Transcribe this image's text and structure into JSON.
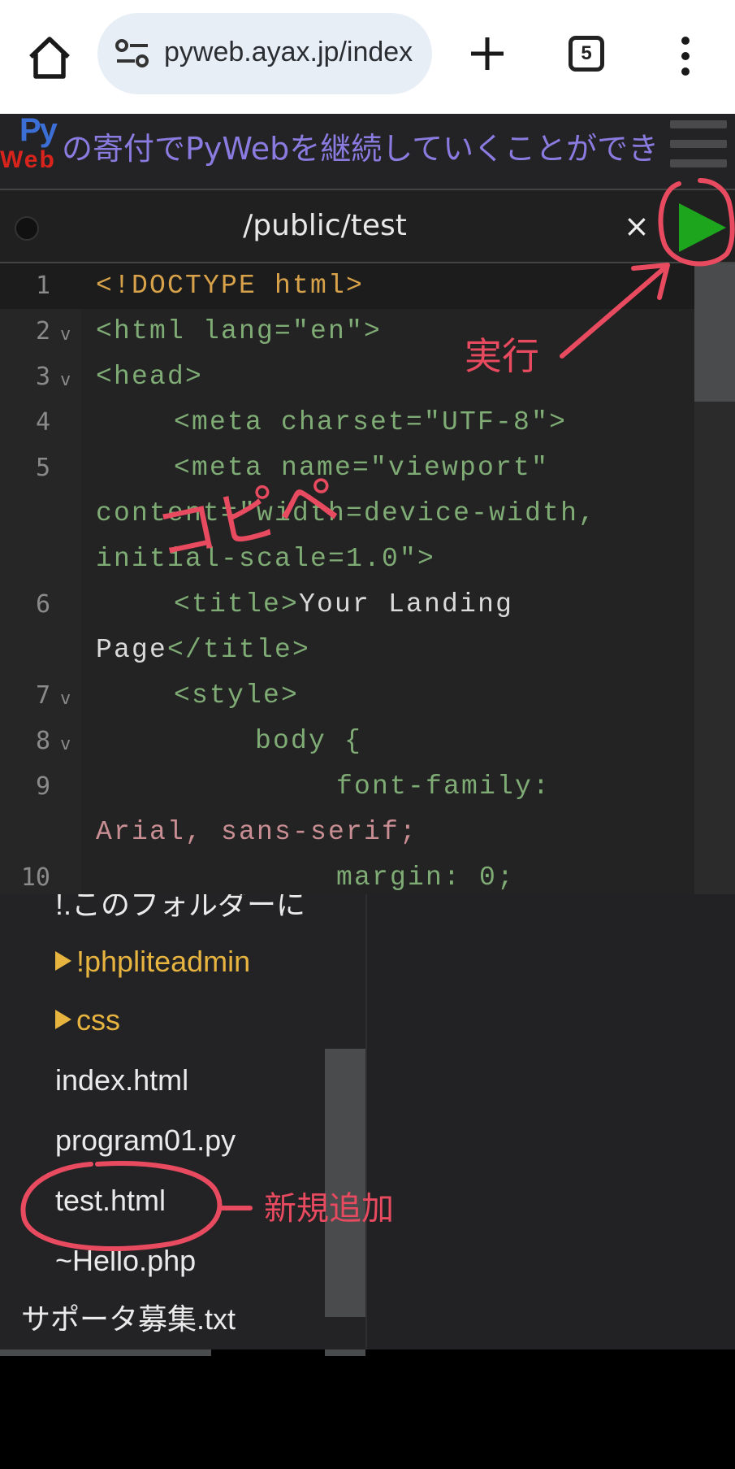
{
  "browser": {
    "url": "pyweb.ayax.jp/index",
    "tab_count": "5",
    "icons": [
      "home-icon",
      "site-settings-icon",
      "new-tab-plus-icon",
      "tab-switcher-icon",
      "more-vert-icon"
    ]
  },
  "banner": {
    "logo_py": "Py",
    "logo_web": "Web",
    "marquee": "の寄付でPyWebを継続していくことができ"
  },
  "editor": {
    "path": "/public/test",
    "close_label": "×",
    "lines": {
      "l1": "1",
      "l2": "2",
      "l3": "3",
      "l4": "4",
      "l5": "5",
      "l6": "6",
      "l7": "7",
      "l8": "8",
      "l9": "9",
      "l10": "10"
    },
    "fold_marker": "v",
    "code": {
      "c1": "<!DOCTYPE html>",
      "c2": "<html lang=\"en\">",
      "c3": "<head>",
      "c4": "<meta charset=\"UTF-8\">",
      "c5a": "<meta name=\"viewport\"",
      "c5b": "content=\"width=device-width,",
      "c5c": "initial-scale=1.0\">",
      "c6a_tag": "<title>",
      "c6a_text": "Your Landing",
      "c6b_text": "Page",
      "c6b_tag": "</title>",
      "c7": "<style>",
      "c8": "body {",
      "c9a": "font-family:",
      "c9b": "Arial, sans-serif;",
      "c10": "margin: 0;"
    }
  },
  "file_tree": {
    "items": [
      {
        "label": "!.このフォルダーに",
        "type": "text"
      },
      {
        "label": "!phpliteadmin",
        "type": "folder"
      },
      {
        "label": "css",
        "type": "folder"
      },
      {
        "label": "index.html",
        "type": "file"
      },
      {
        "label": "program01.py",
        "type": "file"
      },
      {
        "label": "test.html",
        "type": "file"
      },
      {
        "label": "~Hello.php",
        "type": "file"
      },
      {
        "label": "サポータ募集.txt",
        "type": "file"
      }
    ]
  },
  "annotations": {
    "run": "実行",
    "copy_paste": "コピペ",
    "new_add": "新規追加"
  },
  "colors": {
    "accent_annotation": "#e84a5f",
    "run_button": "#1ea51e",
    "folder": "#e8b440"
  }
}
